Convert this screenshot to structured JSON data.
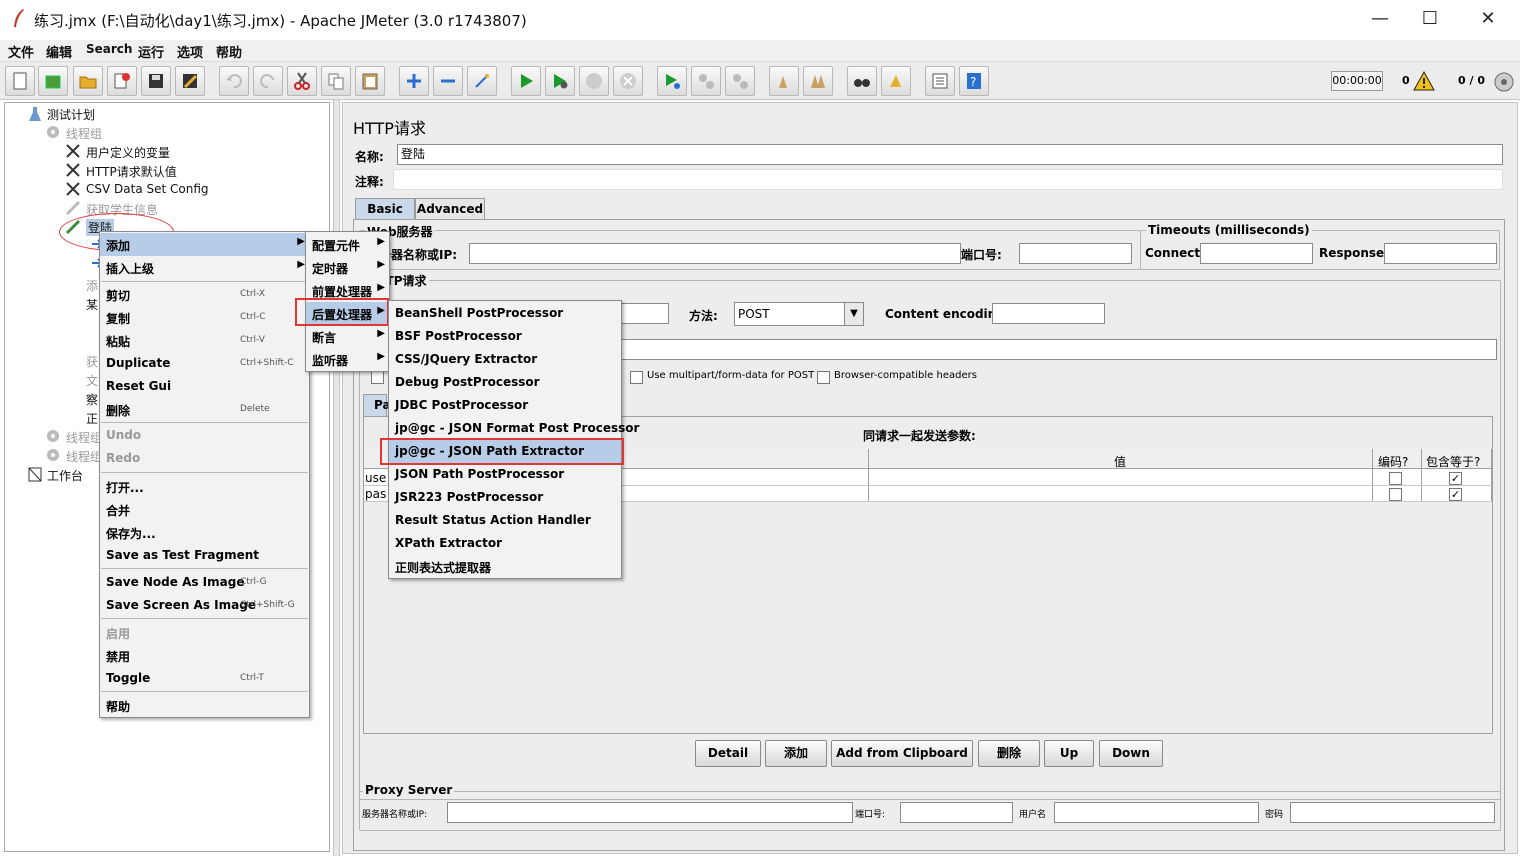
{
  "window": {
    "title": "练习.jmx (F:\\自动化\\day1\\练习.jmx) - Apache JMeter (3.0 r1743807)",
    "minimize": "—",
    "maximize": "☐",
    "close": "✕"
  },
  "menubar": [
    "文件",
    "编辑",
    "Search",
    "运行",
    "选项",
    "帮助"
  ],
  "status": {
    "timer": "00:00:00",
    "errors": "0",
    "threads": "0 / 0"
  },
  "tree": {
    "plan": "测试计划",
    "group1": "线程组",
    "udv": "用户定义的变量",
    "http_defaults": "HTTP请求默认值",
    "csv": "CSV Data Set Config",
    "fetch": "获取学生信息",
    "login": "登陆",
    "add_partial": "添",
    "some_partial": "某",
    "get_partial": "获",
    "file_partial": "文",
    "view_partial": "察",
    "regex_partial": "正",
    "group2": "线程组",
    "group3": "线程组",
    "workbench": "工作台"
  },
  "panel": {
    "title": "HTTP请求",
    "name_label": "名称:",
    "name_value": "登陆",
    "comment_label": "注释:",
    "tabs": [
      "Basic",
      "Advanced"
    ],
    "web_server_group": "Web服务器",
    "server_label": "服务器名称或IP:",
    "port_label": "端口号:",
    "timeouts_group": "Timeouts (milliseconds)",
    "connect_label": "Connect:",
    "response_label": "Response:",
    "http_request_group": "HTTP请求",
    "method_label": "方法:",
    "method_value": "POST",
    "encoding_label": "Content encoding:",
    "multipart_label": "Use multipart/form-data for POST",
    "browser_headers_label": "Browser-compatible headers",
    "params_tab_partial": "Pa",
    "params_title": "同请求一起发送参数:",
    "col_value": "值",
    "col_encode": "编码?",
    "col_include_eq": "包含等于?",
    "rows": [
      {
        "name": "use"
      },
      {
        "name": "pas"
      }
    ],
    "buttons": [
      "Detail",
      "添加",
      "Add from Clipboard",
      "删除",
      "Up",
      "Down"
    ],
    "proxy_group": "Proxy Server",
    "proxy_server_label": "服务器名称或IP:",
    "proxy_port_label": "端口号:",
    "proxy_user_label": "用户名",
    "proxy_pass_label": "密码"
  },
  "context_menu": [
    {
      "label": "添加",
      "submenu": true
    },
    {
      "label": "插入上级",
      "submenu": true
    },
    {
      "label": "剪切",
      "key": "Ctrl-X"
    },
    {
      "label": "复制",
      "key": "Ctrl-C"
    },
    {
      "label": "粘贴",
      "key": "Ctrl-V"
    },
    {
      "label": "Duplicate",
      "key": "Ctrl+Shift-C"
    },
    {
      "label": "Reset Gui"
    },
    {
      "label": "删除",
      "key": "Delete"
    },
    {
      "label": "Undo"
    },
    {
      "label": "Redo"
    },
    {
      "label": "打开..."
    },
    {
      "label": "合并"
    },
    {
      "label": "保存为..."
    },
    {
      "label": "Save as Test Fragment"
    },
    {
      "label": "Save Node As Image",
      "key": "Ctrl-G"
    },
    {
      "label": "Save Screen As Image",
      "key": "Ctrl+Shift-G"
    },
    {
      "label": "启用"
    },
    {
      "label": "禁用"
    },
    {
      "label": "Toggle",
      "key": "Ctrl-T"
    },
    {
      "label": "帮助"
    }
  ],
  "add_submenu": [
    "配置元件",
    "定时器",
    "前置处理器",
    "后置处理器",
    "断言",
    "监听器"
  ],
  "post_processor_submenu": [
    "BeanShell PostProcessor",
    "BSF PostProcessor",
    "CSS/JQuery Extractor",
    "Debug PostProcessor",
    "JDBC PostProcessor",
    "jp@gc - JSON Format Post Processor",
    "jp@gc - JSON Path Extractor",
    "JSON Path PostProcessor",
    "JSR223 PostProcessor",
    "Result Status Action Handler",
    "XPath Extractor",
    "正则表达式提取器"
  ]
}
